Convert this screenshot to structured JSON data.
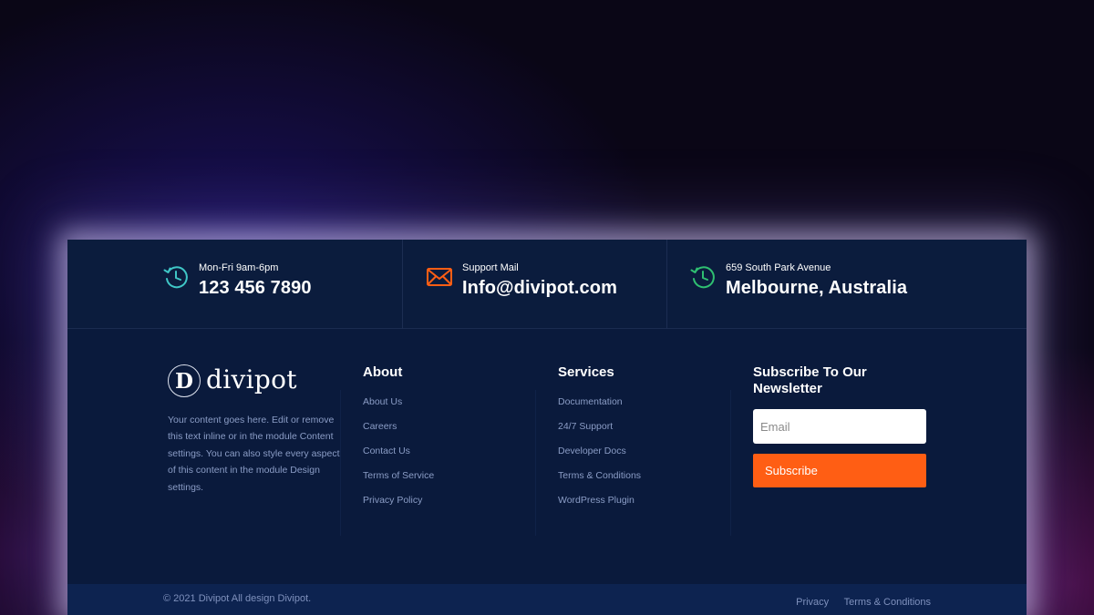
{
  "contact": [
    {
      "label": "Mon-Fri 9am-6pm",
      "value": "123 456 7890",
      "icon": "clock-history-icon",
      "color": "#3fc6c6"
    },
    {
      "label": "Support Mail",
      "value": "Info@divipot.com",
      "icon": "envelope-icon",
      "color": "#ff5e14"
    },
    {
      "label": "659 South Park Avenue",
      "value": "Melbourne, Australia",
      "icon": "clock-history-icon",
      "color": "#2fbf71"
    }
  ],
  "brand": {
    "logo_letter": "D",
    "name": "divipot",
    "description": "Your content goes here. Edit or remove this text inline or in the module Content settings. You can also style every aspect of this content in the module Design settings."
  },
  "about": {
    "title": "About",
    "links": [
      "About Us",
      "Careers",
      "Contact Us",
      "Terms of Service",
      "Privacy Policy"
    ]
  },
  "services": {
    "title": "Services",
    "links": [
      "Documentation",
      "24/7 Support",
      "Developer Docs",
      "Terms & Conditions",
      "WordPress Plugin"
    ]
  },
  "newsletter": {
    "title": "Subscribe To Our Newsletter",
    "email_placeholder": "Email",
    "button_label": "Subscribe"
  },
  "footer": {
    "copyright": "© 2021 Divipot All design Divipot.",
    "links": [
      "Privacy",
      "Terms & Conditions"
    ]
  },
  "colors": {
    "accent": "#ff5e14",
    "footer_bg": "#0a1a3c",
    "bottom_bar_bg": "#0d2350"
  }
}
